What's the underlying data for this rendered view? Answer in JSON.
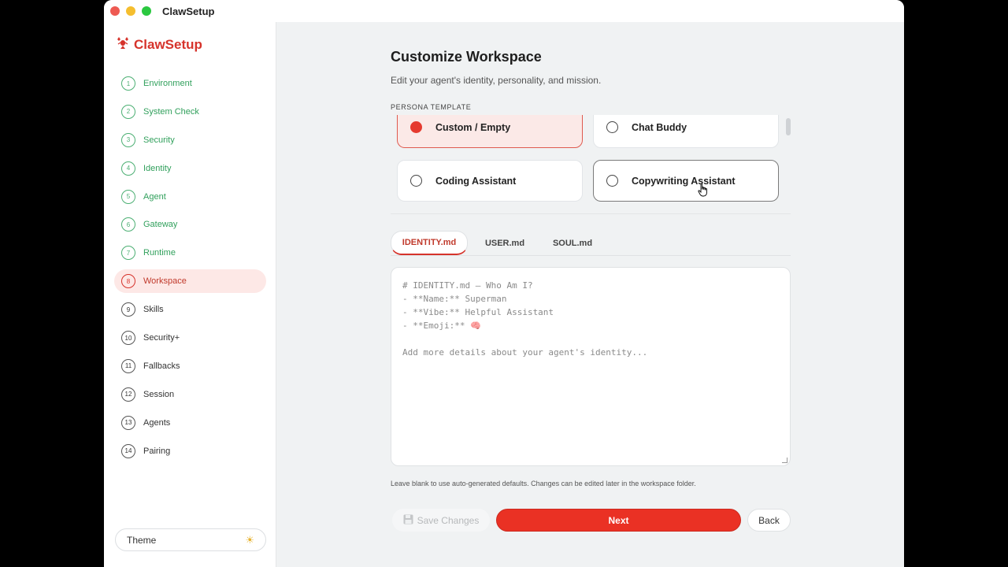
{
  "window": {
    "title": "ClawSetup"
  },
  "sidebar": {
    "brand": "ClawSetup",
    "steps": [
      {
        "num": "1",
        "label": "Environment",
        "state": "done"
      },
      {
        "num": "2",
        "label": "System Check",
        "state": "done"
      },
      {
        "num": "3",
        "label": "Security",
        "state": "done"
      },
      {
        "num": "4",
        "label": "Identity",
        "state": "done"
      },
      {
        "num": "5",
        "label": "Agent",
        "state": "done"
      },
      {
        "num": "6",
        "label": "Gateway",
        "state": "done"
      },
      {
        "num": "7",
        "label": "Runtime",
        "state": "done"
      },
      {
        "num": "8",
        "label": "Workspace",
        "state": "active"
      },
      {
        "num": "9",
        "label": "Skills",
        "state": "pending"
      },
      {
        "num": "10",
        "label": "Security+",
        "state": "pending"
      },
      {
        "num": "11",
        "label": "Fallbacks",
        "state": "pending"
      },
      {
        "num": "12",
        "label": "Session",
        "state": "pending"
      },
      {
        "num": "13",
        "label": "Agents",
        "state": "pending"
      },
      {
        "num": "14",
        "label": "Pairing",
        "state": "pending"
      }
    ],
    "theme_label": "Theme",
    "theme_icon": "sun-icon"
  },
  "main": {
    "title": "Customize Workspace",
    "subtitle": "Edit your agent's identity, personality, and mission.",
    "persona_section_label": "PERSONA TEMPLATE",
    "personas": [
      {
        "label": "Custom / Empty",
        "selected": true
      },
      {
        "label": "Chat Buddy",
        "selected": false
      },
      {
        "label": "Coding Assistant",
        "selected": false
      },
      {
        "label": "Copywriting Assistant",
        "selected": false
      }
    ],
    "tabs": [
      {
        "label": "IDENTITY.md",
        "active": true
      },
      {
        "label": "USER.md",
        "active": false
      },
      {
        "label": "SOUL.md",
        "active": false
      }
    ],
    "editor": {
      "lines": [
        "# IDENTITY.md — Who Am I?",
        "- **Name:** Superman",
        "- **Vibe:** Helpful Assistant",
        "- **Emoji:** 🧠"
      ],
      "placeholder": "Add more details about your agent's identity..."
    },
    "hint": "Leave blank to use auto-generated defaults. Changes can be edited later in the workspace folder.",
    "buttons": {
      "save": "Save Changes",
      "next": "Next",
      "back": "Back"
    }
  },
  "colors": {
    "accent": "#ea3124",
    "done_green": "#31a05c",
    "active_bg": "#fde8e6"
  }
}
